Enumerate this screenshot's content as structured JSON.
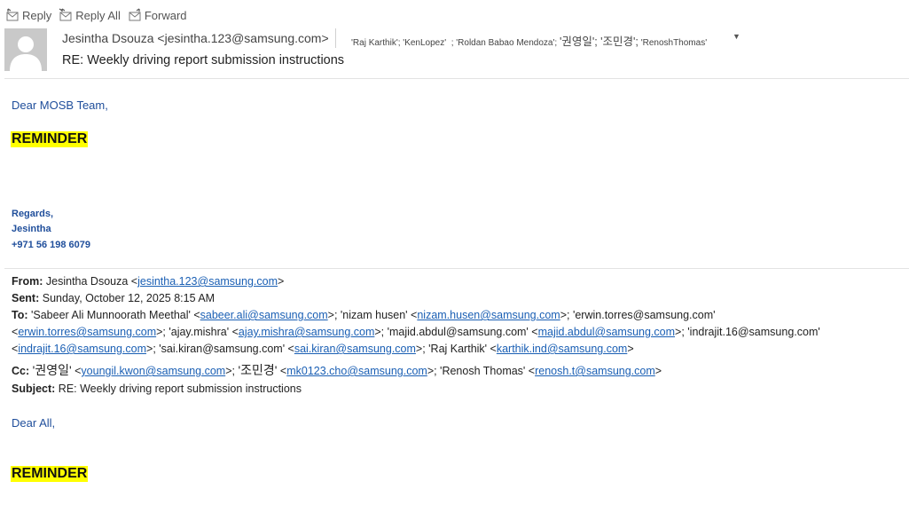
{
  "toolbar": {
    "reply": "Reply",
    "reply_all": "Reply All",
    "forward": "Forward"
  },
  "header": {
    "sender_name": "Jesintha Dsouza",
    "sender_email": "jesintha.123@samsung.com",
    "subject": "RE: Weekly driving report submission instructions",
    "recipients": {
      "r1": "'Raj Karthik'; 'KenLopez'",
      "r2": "; 'Roldan Babao Mendoza';",
      "r3": "'권영일'; '조민경';",
      "r4": "'RenoshThomas'"
    }
  },
  "message": {
    "greeting": "Dear MOSB Team,",
    "reminder": "REMINDER",
    "signature": {
      "regards": "Regards,",
      "name": "Jesintha",
      "phone": "+971 56 198 6079"
    }
  },
  "quoted": {
    "from_label": "From:",
    "from_name": "Jesintha Dsouza <",
    "from_email": "jesintha.123@samsung.com",
    "sent_label": "Sent:",
    "sent_value": "Sunday, October 12, 2025 8:15 AM",
    "to_label": "To:",
    "to": {
      "a": "'Sabeer Ali Munnoorath Meethal' <",
      "a_email": "sabeer.ali@samsung.com",
      "b": ">; 'nizam husen' <",
      "b_email": "nizam.husen@samsung.com",
      "c": ">; 'erwin.torres@samsung.com'",
      "c_email": "erwin.torres@samsung.com",
      "d": ">; 'ajay.mishra' <",
      "d_email": "ajay.mishra@samsung.com",
      "e": ">; 'majid.abdul@samsung.com' <",
      "e_email": "majid.abdul@samsung.com",
      "f": ">; 'indrajit.16@samsung.com'",
      "f_email": "indrajit.16@samsung.com",
      "g": ">; 'sai.kiran@samsung.com' <",
      "g_email": "sai.kiran@samsung.com",
      "h": ">; 'Raj Karthik' <",
      "h_email": "karthik.ind@samsung.com"
    },
    "cc_label": "Cc:",
    "cc": {
      "a_name": "'권영일'",
      "a_email": "youngil.kwon@samsung.com",
      "b_name": "'조민경'",
      "b_email": "mk0123.cho@samsung.com",
      "c": ">; 'Renosh Thomas' <",
      "c_email": "renosh.t@samsung.com"
    },
    "subject_label": "Subject:",
    "subject_value": "RE: Weekly driving report submission instructions",
    "greeting": "Dear All,",
    "reminder": "REMINDER"
  },
  "colors": {
    "highlight": "#ffff00",
    "link": "#1a5fb4",
    "signature": "#1f4e9b"
  }
}
